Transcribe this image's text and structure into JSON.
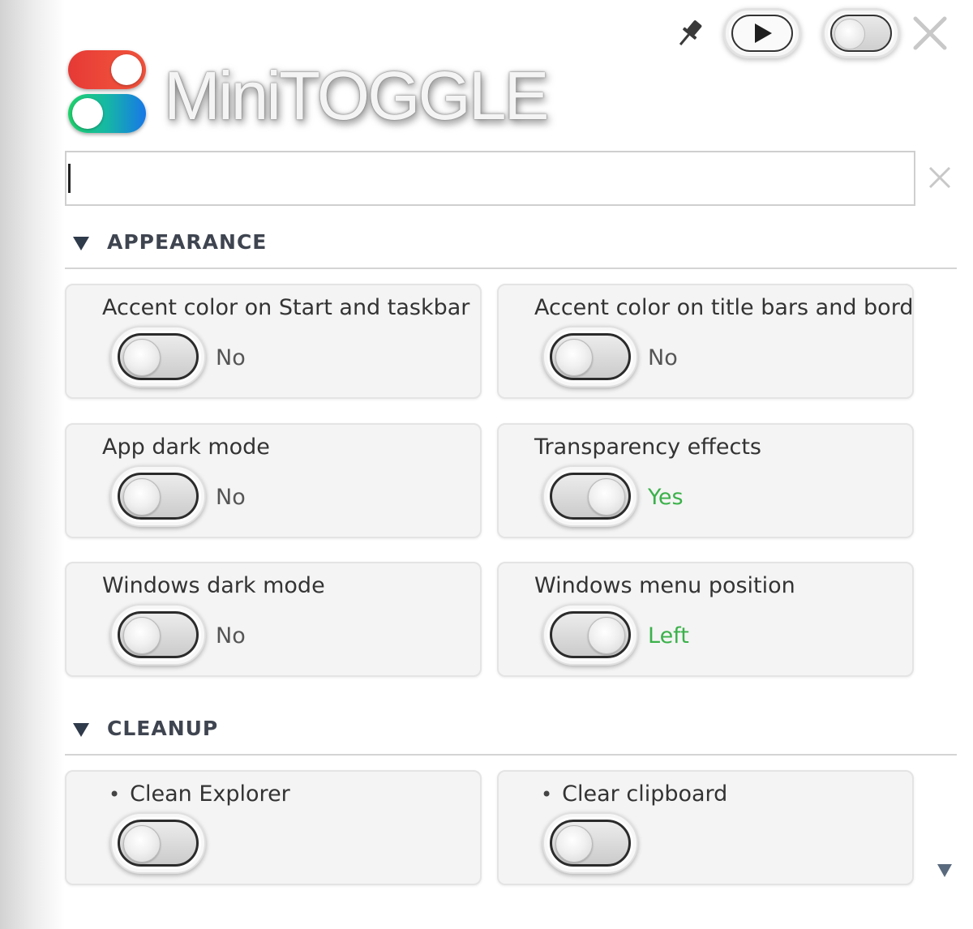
{
  "app": {
    "logo_text": "MiniTOGGLE"
  },
  "toolbar": {
    "pin_icon": "pin-icon",
    "play_icon": "play-icon",
    "toggle_icon": "toggle-icon",
    "close_icon": "close-icon"
  },
  "search": {
    "value": "",
    "placeholder": "",
    "clear_icon": "clear-icon"
  },
  "sections": [
    {
      "title": "APPEARANCE",
      "items": [
        {
          "label": "Accent color on Start and taskbar",
          "state": "No",
          "on": false
        },
        {
          "label": "Accent color on title bars and borders",
          "state": "No",
          "on": false
        },
        {
          "label": "App dark mode",
          "state": "No",
          "on": false
        },
        {
          "label": "Transparency effects",
          "state": "Yes",
          "on": true
        },
        {
          "label": "Windows dark mode",
          "state": "No",
          "on": false
        },
        {
          "label": "Windows menu position",
          "state": "Left",
          "on": true
        }
      ]
    },
    {
      "title": "CLEANUP",
      "items": [
        {
          "label": "Clean Explorer",
          "on": false
        },
        {
          "label": "Clear clipboard",
          "on": false
        }
      ]
    }
  ],
  "colors": {
    "state_on": "#3bb14a",
    "state_off": "#555555",
    "logo_red": "#e53935",
    "logo_green": "#1fd26b",
    "logo_blue": "#1777e8"
  }
}
